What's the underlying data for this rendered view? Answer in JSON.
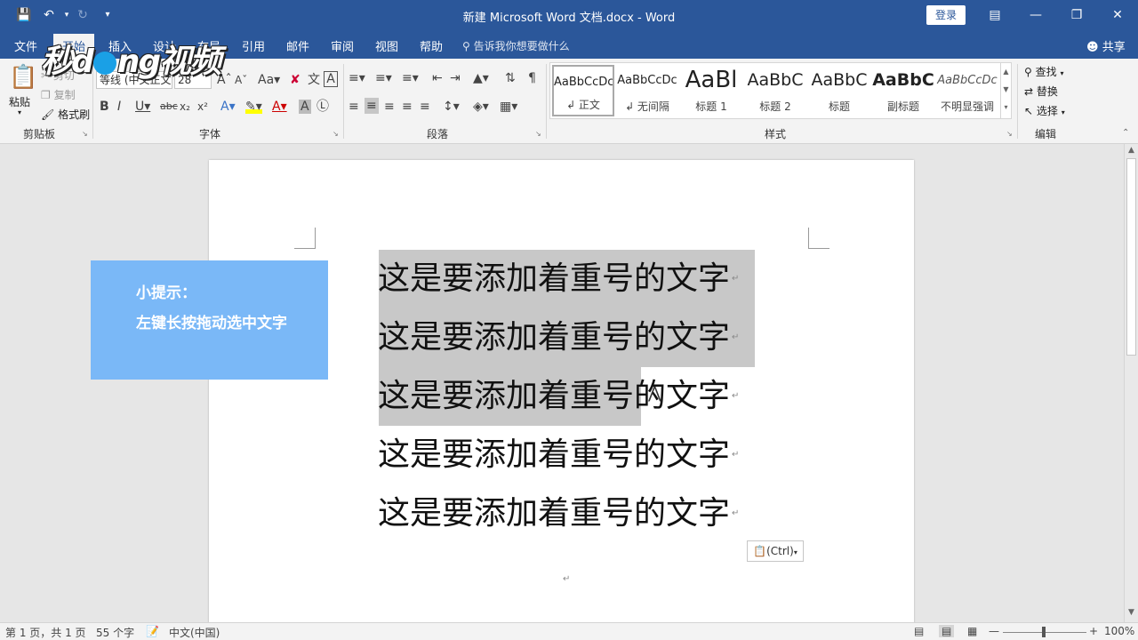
{
  "window": {
    "title": "新建 Microsoft Word 文档.docx  -  Word",
    "login": "登录",
    "share": "共享",
    "tell_me": "告诉我你想要做什么"
  },
  "tabs": [
    "文件",
    "开始",
    "插入",
    "设计",
    "布局",
    "引用",
    "邮件",
    "审阅",
    "视图",
    "帮助"
  ],
  "ribbon": {
    "clipboard": {
      "paste": "粘贴",
      "cut": "剪切",
      "copy": "复制",
      "format_painter": "格式刷",
      "label": "剪贴板"
    },
    "font": {
      "name": "等线 (中文正文)",
      "size": "28",
      "label": "字体"
    },
    "paragraph": {
      "label": "段落"
    },
    "styles": {
      "label": "样式",
      "items": [
        {
          "sample": "AaBbCcDc",
          "name": "↲ 正文"
        },
        {
          "sample": "AaBbCcDc",
          "name": "↲ 无间隔"
        },
        {
          "sample": "AaBl",
          "name": "标题 1"
        },
        {
          "sample": "AaBbC",
          "name": "标题 2"
        },
        {
          "sample": "AaBbC",
          "name": "标题"
        },
        {
          "sample": "AaBbC",
          "name": "副标题"
        },
        {
          "sample": "AaBbCcDc",
          "name": "不明显强调"
        }
      ]
    },
    "editing": {
      "find": "查找",
      "replace": "替换",
      "select": "选择",
      "label": "编辑"
    }
  },
  "document": {
    "lines": [
      "这是要添加着重号的文字",
      "这是要添加着重号的文字",
      "这是要添加着重号的文字",
      "这是要添加着重号的文字",
      "这是要添加着重号的文字"
    ],
    "paste_options": "(Ctrl)",
    "tip_title": "小提示：",
    "tip_text": "左键长按拖动选中文字"
  },
  "statusbar": {
    "page": "第 1 页，共 1 页",
    "words": "55 个字",
    "language": "中文(中国)",
    "zoom": "100%"
  },
  "watermark": "秒懂视频",
  "colors": {
    "titlebar": "#2b579a",
    "tip_box": "#7ab8f7",
    "selection": "#c8c8c8"
  }
}
